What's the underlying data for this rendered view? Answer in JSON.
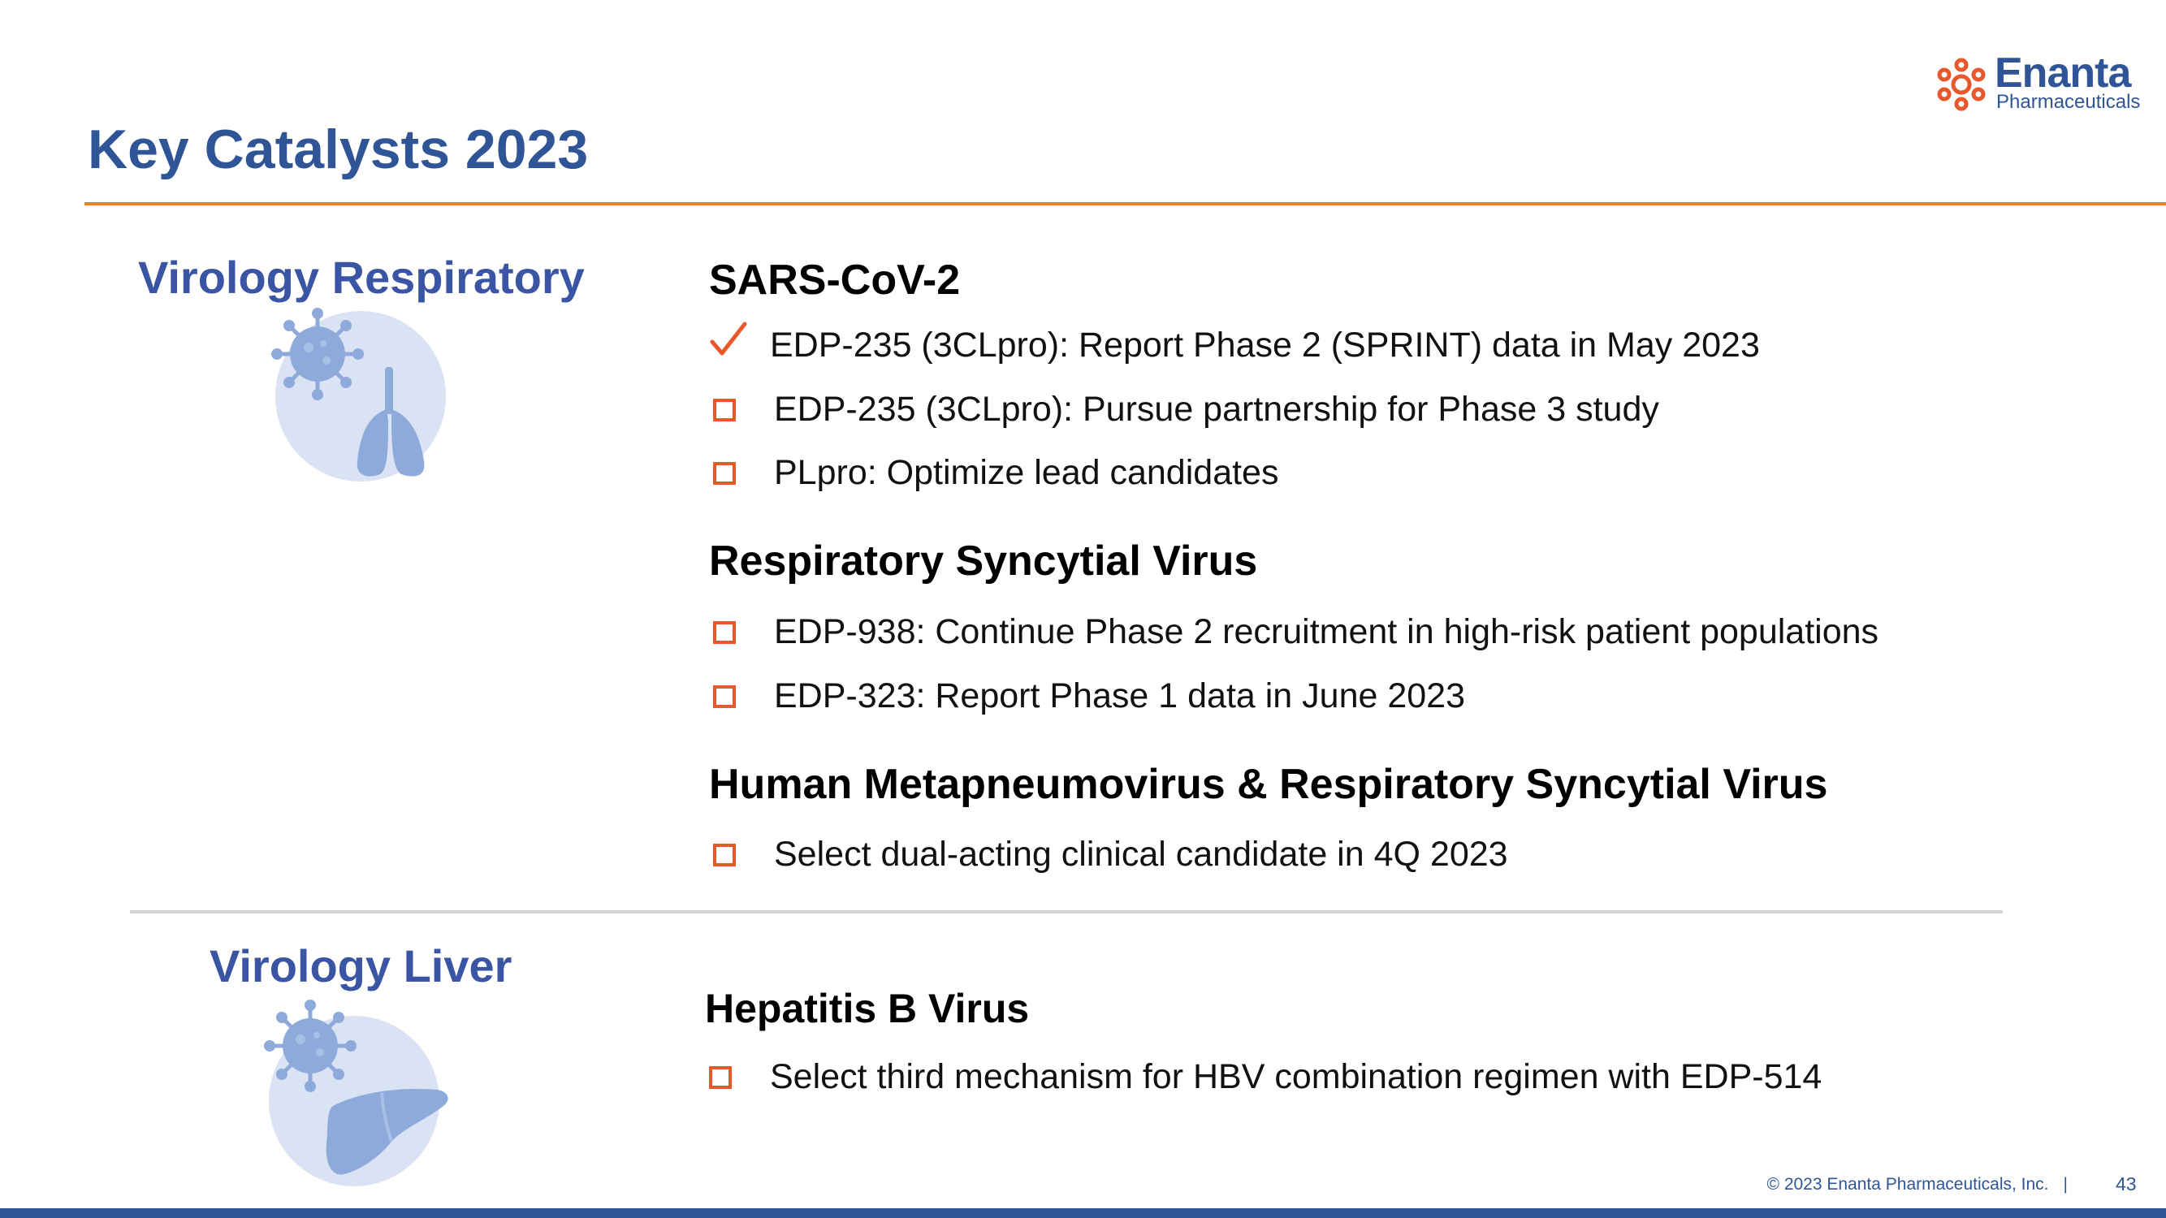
{
  "slide": {
    "title": "Key Catalysts 2023"
  },
  "logo": {
    "name": "Enanta",
    "subtitle": "Pharmaceuticals"
  },
  "areas": [
    {
      "heading": "Virology Respiratory",
      "icon": "virus-lungs-icon",
      "groups": [
        {
          "title": "SARS-CoV-2",
          "items": [
            {
              "status": "done",
              "text": "EDP-235 (3CLpro): Report Phase 2 (SPRINT) data in May 2023"
            },
            {
              "status": "pending",
              "text": "EDP-235 (3CLpro): Pursue partnership for Phase 3 study"
            },
            {
              "status": "pending",
              "text": "PLpro: Optimize lead candidates"
            }
          ]
        },
        {
          "title": "Respiratory Syncytial Virus",
          "items": [
            {
              "status": "pending",
              "text": "EDP-938: Continue Phase 2 recruitment in high-risk patient populations"
            },
            {
              "status": "pending",
              "text": "EDP-323: Report Phase 1 data in June 2023"
            }
          ]
        },
        {
          "title": "Human Metapneumovirus & Respiratory Syncytial Virus",
          "items": [
            {
              "status": "pending",
              "text": "Select dual-acting clinical candidate in 4Q 2023"
            }
          ]
        }
      ]
    },
    {
      "heading": "Virology Liver",
      "icon": "virus-liver-icon",
      "groups": [
        {
          "title": "Hepatitis B Virus",
          "items": [
            {
              "status": "pending",
              "text": "Select third mechanism for HBV combination regimen with EDP-514"
            }
          ]
        }
      ]
    }
  ],
  "footer": {
    "copyright": "© 2023  Enanta Pharmaceuticals, Inc.",
    "separator": "|",
    "page_number": "43"
  },
  "colors": {
    "title": "#2f5597",
    "accent": "#ed7d31",
    "checkbox": "#e8582a",
    "icon_circle": "#dae3f3",
    "icon_fill": "#8eaadb"
  }
}
